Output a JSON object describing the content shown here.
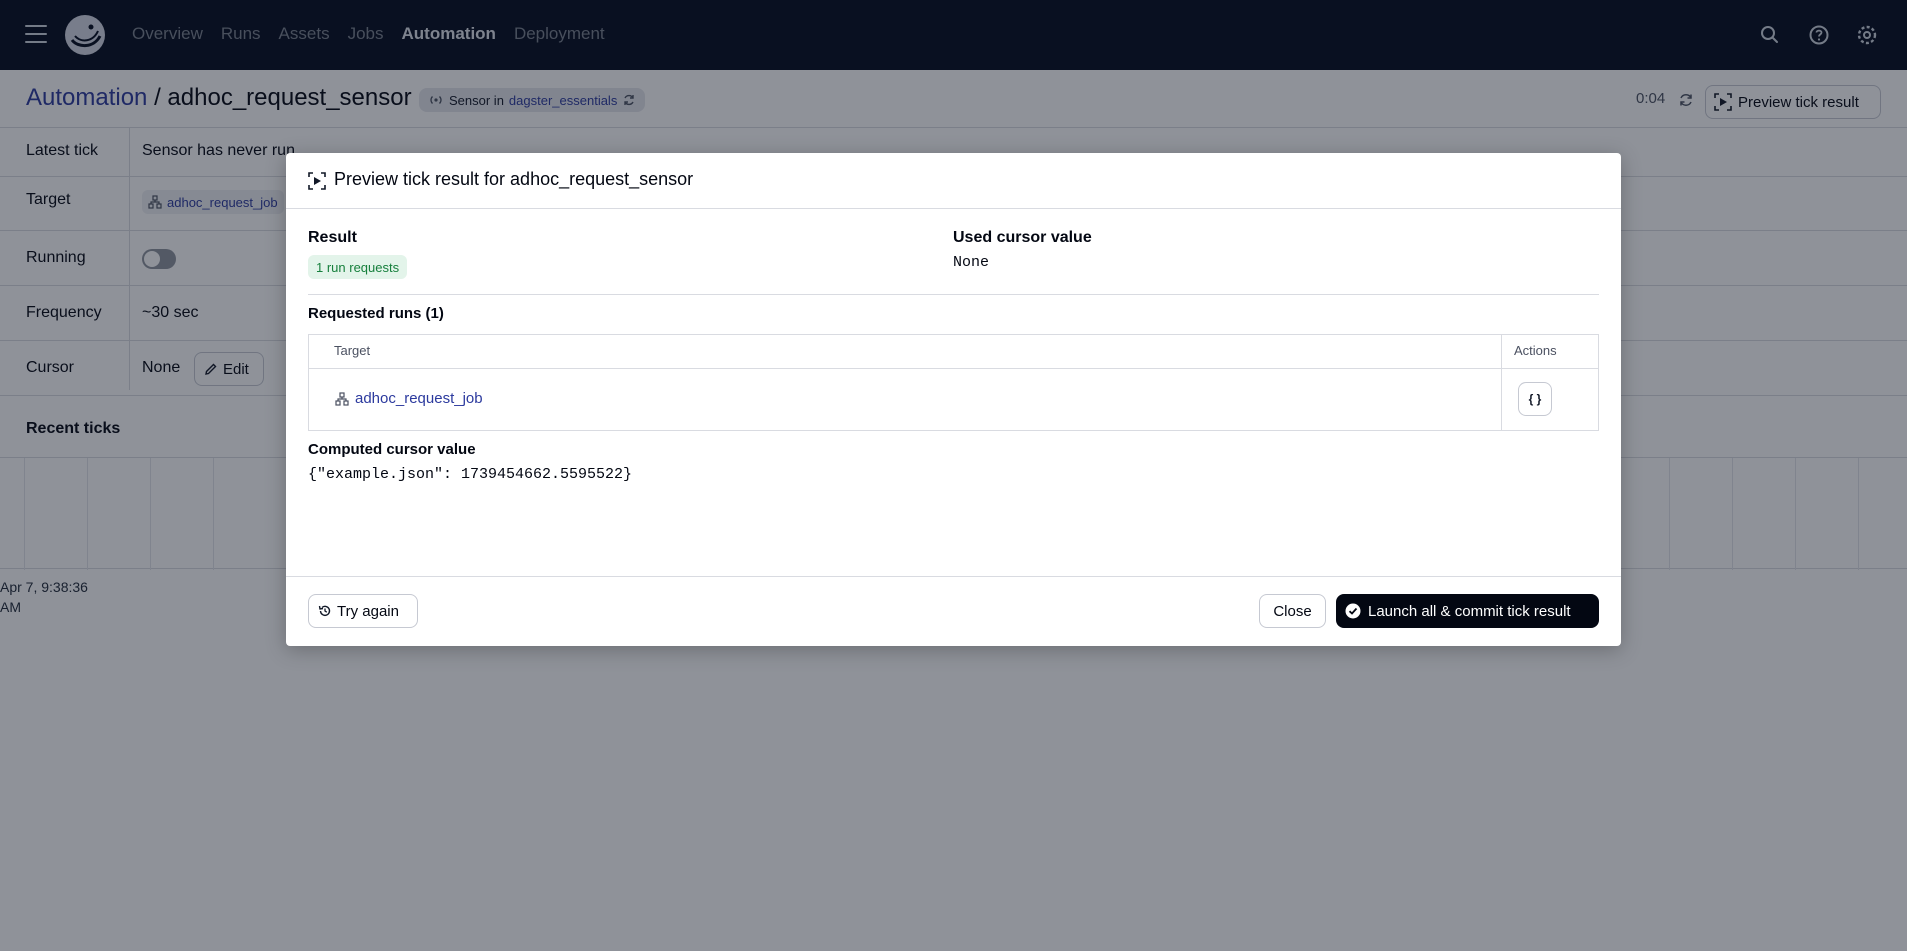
{
  "nav": {
    "links": [
      "Overview",
      "Runs",
      "Assets",
      "Jobs",
      "Automation",
      "Deployment"
    ],
    "active": "Automation"
  },
  "breadcrumb": {
    "root": "Automation",
    "separator": "/",
    "current": "adhoc_request_sensor"
  },
  "sensor_tag": {
    "prefix": "Sensor in",
    "location": "dagster_essentials"
  },
  "header_actions": {
    "timer": "0:04",
    "preview_label": "Preview tick result"
  },
  "details": {
    "latest_tick_label": "Latest tick",
    "latest_tick_value": "Sensor has never run",
    "target_label": "Target",
    "target_value": "adhoc_request_job",
    "running_label": "Running",
    "frequency_label": "Frequency",
    "frequency_value": "~30 sec",
    "cursor_label": "Cursor",
    "cursor_value": "None",
    "edit_label": "Edit"
  },
  "recent_ticks": {
    "title": "Recent ticks",
    "timestamp_line1": "Apr 7, 9:38:36",
    "timestamp_line2": "AM"
  },
  "dialog": {
    "title": "Preview tick result for adhoc_request_sensor",
    "result_label": "Result",
    "result_badge": "1 run requests",
    "used_cursor_label": "Used cursor value",
    "used_cursor_value": "None",
    "requested_runs_label": "Requested runs (1)",
    "table": {
      "col_target": "Target",
      "col_actions": "Actions",
      "rows": [
        {
          "target": "adhoc_request_job",
          "action_icon": "code-braces-icon"
        }
      ]
    },
    "computed_cursor_label": "Computed cursor value",
    "computed_cursor_value": "{\"example.json\": 1739454662.5595522}",
    "try_again_label": "Try again",
    "close_label": "Close",
    "launch_label": "Launch all & commit tick result"
  },
  "colors": {
    "nav_bg": "#030b1e",
    "link": "#2c3a9e",
    "badge_green_bg": "#e3f4ea",
    "badge_green_text": "#17803d",
    "primary_button": "#030712",
    "overlay": "rgba(17,24,39,0.47)"
  }
}
